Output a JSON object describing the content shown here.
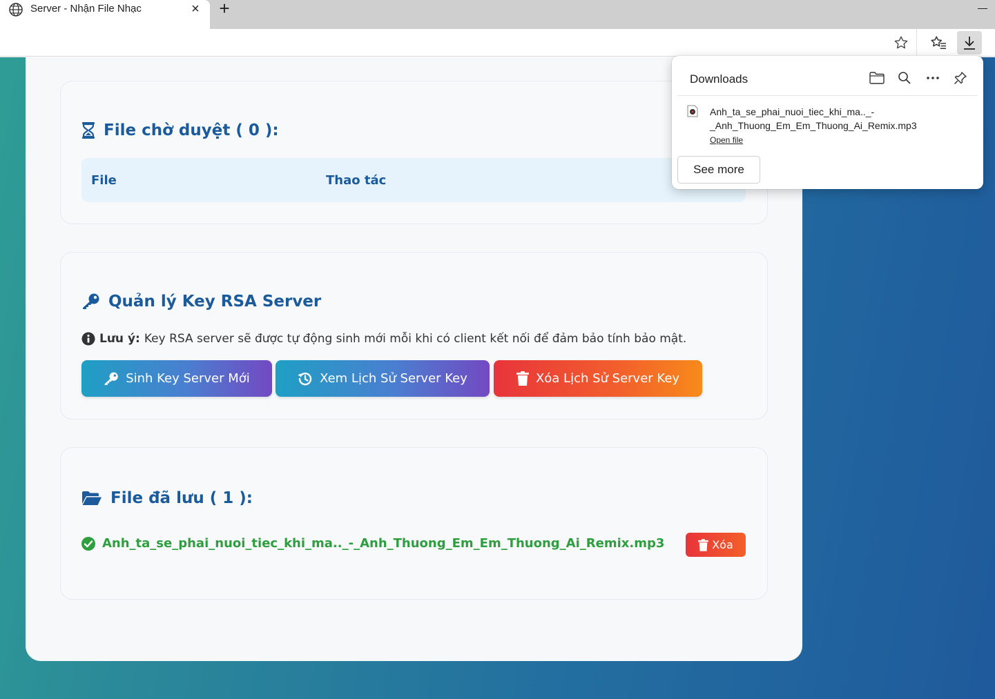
{
  "browser": {
    "tab_title": "Server - Nhận File Nhạc",
    "tab_close": "×",
    "new_tab": "+"
  },
  "pending": {
    "title": "File chờ duyệt (  0  ):",
    "columns": [
      "File",
      "Thao tác"
    ],
    "count": 0
  },
  "keys": {
    "title": "Quản lý Key RSA Server",
    "note_label": "Lưu ý:",
    "note_text": "Key RSA server sẽ được tự động sinh mới mỗi khi có client kết nối để đảm bảo tính bảo mật.",
    "buttons": {
      "generate": "Sinh Key Server Mới",
      "history": "Xem Lịch Sử Server Key",
      "clear": "Xóa Lịch Sử Server Key"
    }
  },
  "saved": {
    "title": "File đã lưu (  1  ):",
    "count": 1,
    "files": [
      {
        "name": "Anh_ta_se_phai_nuoi_tiec_khi_ma.._-_Anh_Thuong_Em_Em_Thuong_Ai_Remix.mp3",
        "delete_label": "Xóa"
      }
    ]
  },
  "downloads": {
    "title": "Downloads",
    "file_line1": "Anh_ta_se_phai_nuoi_tiec_khi_ma.._-",
    "file_line2": "_Anh_Thuong_Em_Em_Thuong_Ai_Remix.mp3",
    "open_file": "Open file",
    "see_more": "See more"
  },
  "colors": {
    "heading": "#1c5b9b",
    "success": "#2e9e3e",
    "danger": "#e8343b"
  }
}
